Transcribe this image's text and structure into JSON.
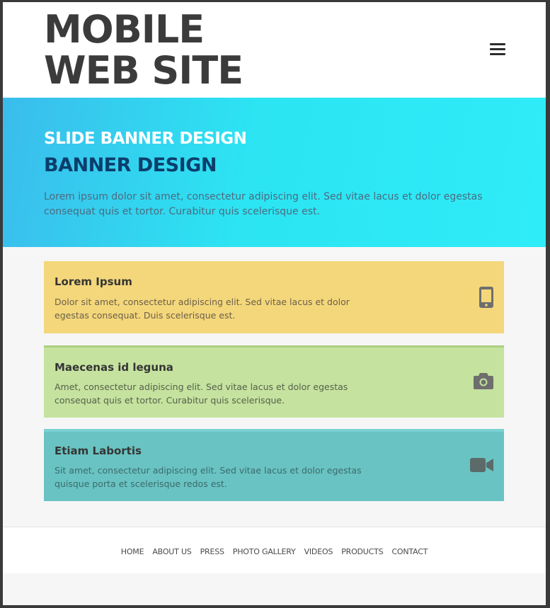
{
  "header": {
    "logo_line1": "MOBILE",
    "logo_line2": "WEB SITE",
    "menu_icon": "hamburger-menu-icon"
  },
  "banner": {
    "title": "SLIDE BANNER DESIGN",
    "subtitle": "BANNER DESIGN",
    "text": "Lorem ipsum dolor sit amet, consectetur adipiscing elit. Sed vitae lacus et dolor egestas consequat quis et tortor. Curabitur quis scelerisque est."
  },
  "cards": [
    {
      "title": "Lorem Ipsum",
      "text": "Dolor sit amet, consectetur adipiscing elit. Sed vitae lacus et dolor egestas consequat. Duis scelerisque est.",
      "icon": "mobile-phone-icon",
      "color": "#f4d77b"
    },
    {
      "title": "Maecenas id leguna",
      "text": "Amet, consectetur adipiscing elit. Sed vitae lacus et dolor egestas consequat quis et tortor. Curabitur quis scelerisque.",
      "icon": "camera-icon",
      "color": "#c5e29f"
    },
    {
      "title": "Etiam Labortis",
      "text": "Sit amet, consectetur adipiscing elit. Sed vitae lacus et dolor egestas quisque porta et scelerisque redos est.",
      "icon": "video-camera-icon",
      "color": "#69c3c2"
    }
  ],
  "footer": {
    "nav": [
      "HOME",
      "ABOUT US",
      "PRESS",
      "PHOTO GALLERY",
      "VIDEOS",
      "PRODUCTS",
      "CONTACT"
    ]
  },
  "colors": {
    "banner_start": "#3bbcec",
    "banner_end": "#2eecf8",
    "subtitle": "#0b3e6c",
    "logo": "#3b3b3b"
  }
}
